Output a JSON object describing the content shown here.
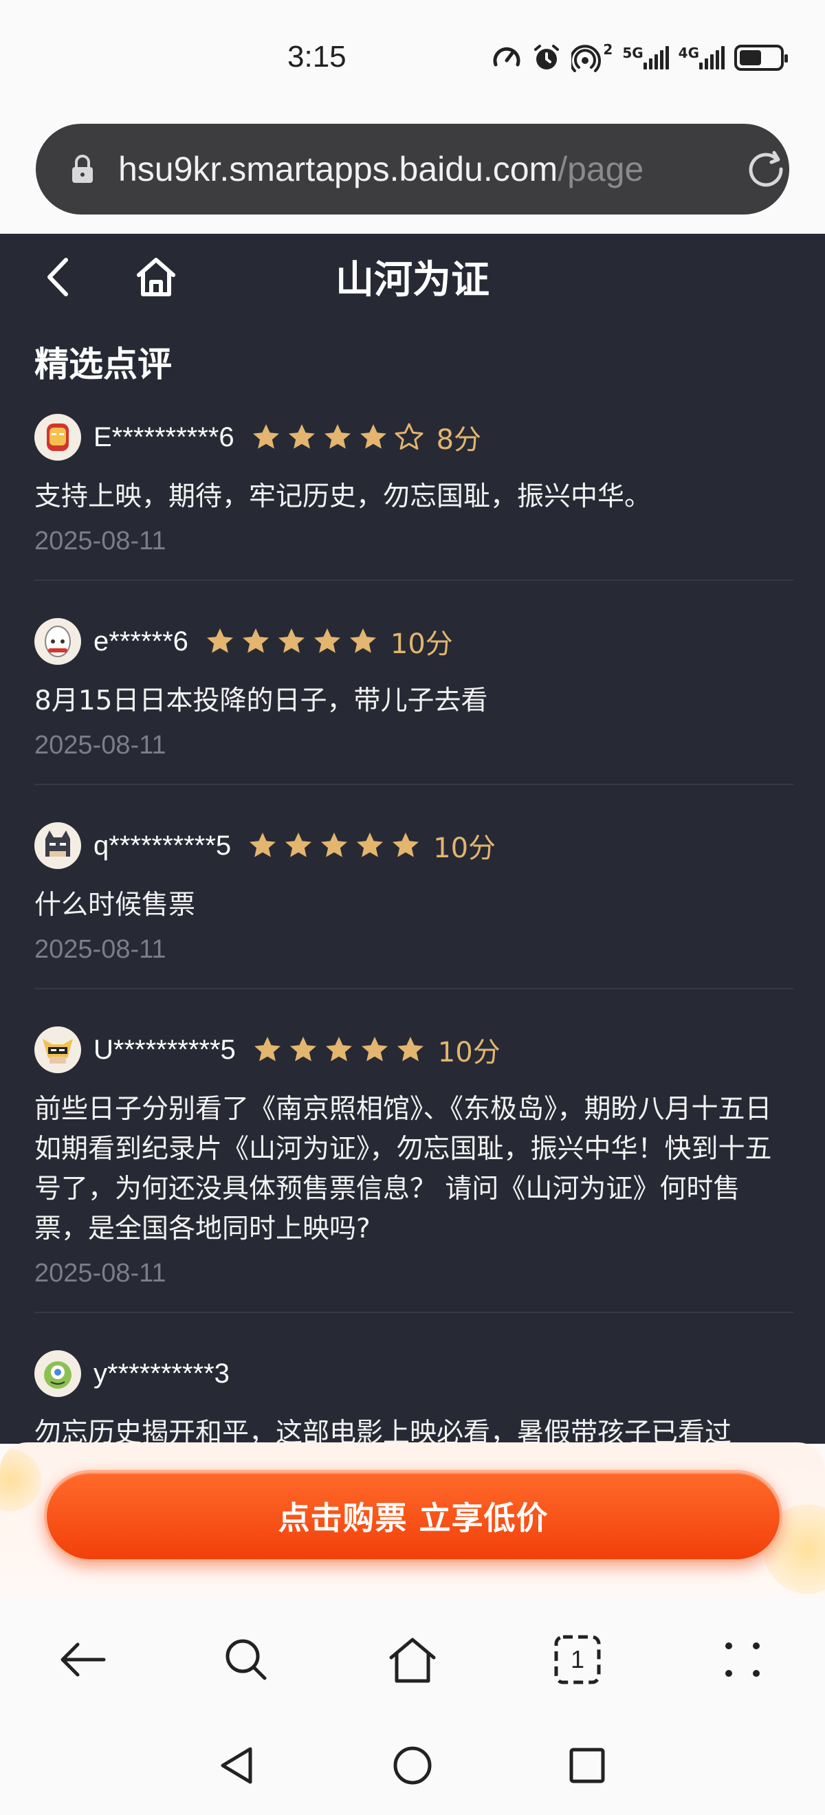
{
  "status_bar": {
    "time": "3:15",
    "sim1_label": "5G",
    "sim2_label": "4G",
    "hotspot_count": "2",
    "battery_level": 0.55,
    "icons": [
      "speed-icon",
      "alarm-icon",
      "hotspot-icon",
      "signal-icon",
      "signal-icon",
      "battery-icon"
    ]
  },
  "url_bar": {
    "url_main": "hsu9kr.smartapps.baidu.com",
    "url_rest": "/page"
  },
  "header": {
    "title": "山河为证"
  },
  "section": {
    "title": "精选点评"
  },
  "reviews": [
    {
      "user": "E**********6",
      "rating": 4,
      "score": "8分",
      "text": "支持上映，期待，牢记历史，勿忘国耻，振兴中华。",
      "date": "2025-08-11",
      "avatar": "ironman-avatar"
    },
    {
      "user": "e******6",
      "rating": 5,
      "score": "10分",
      "text": "8月15日日本投降的日子，带儿子去看",
      "date": "2025-08-11",
      "avatar": "robot-avatar"
    },
    {
      "user": "q**********5",
      "rating": 5,
      "score": "10分",
      "text": "什么时候售票",
      "date": "2025-08-11",
      "avatar": "batman-avatar"
    },
    {
      "user": "U**********5",
      "rating": 5,
      "score": "10分",
      "text": "前些日子分别看了《南京照相馆》、《东极岛》，期盼八月十五日如期看到纪录片《山河为证》，勿忘国耻，振兴中华！快到十五号了，为何还没具体预售票信息？ 请问《山河为证》何时售票，是全国各地同时上映吗?",
      "date": "2025-08-11",
      "avatar": "wolverine-avatar"
    },
    {
      "user": "y**********3",
      "rating": 0,
      "score": "",
      "text": "勿忘历史揭开和平，这部电影上映必看，暑假带孩子已看过",
      "date": "",
      "avatar": "monster-avatar"
    }
  ],
  "buy": {
    "label": "点击购票 立享低价"
  },
  "toolbar": {
    "tab_count": "1",
    "icons": [
      "back-arrow-icon",
      "search-icon",
      "home-icon",
      "tabs-icon",
      "more-icon"
    ]
  },
  "colors": {
    "content_bg": "#272a34",
    "star": "#e3b56f",
    "buy_button": "#f2400a"
  }
}
